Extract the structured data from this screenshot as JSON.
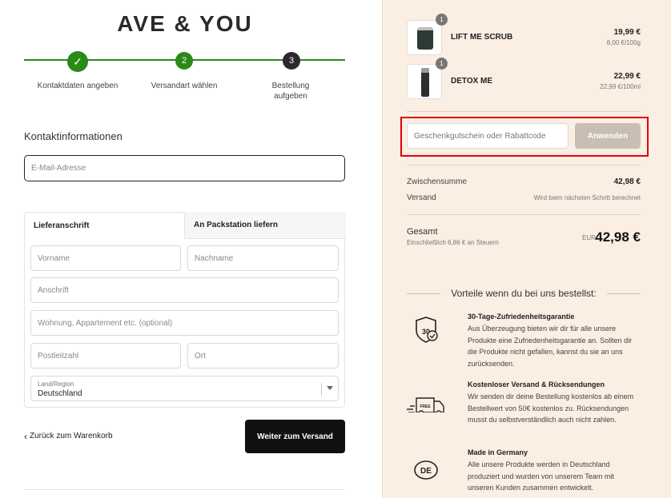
{
  "brand": {
    "logo_text": "AVE & YOU"
  },
  "steps": [
    {
      "label": "Kontaktdaten angeben",
      "marker": "✓"
    },
    {
      "label": "Versandart wählen",
      "marker": "2"
    },
    {
      "label": "Bestellung aufgeben",
      "marker": "3"
    }
  ],
  "contact": {
    "title": "Kontaktinformationen",
    "email_placeholder": "E-Mail-Adresse"
  },
  "shipping": {
    "tabs": [
      "Lieferanschrift",
      "An Packstation liefern"
    ],
    "fields": {
      "vorname": "Vorname",
      "nachname": "Nachname",
      "anschrift": "Anschrift",
      "wohnung": "Wohnung, Appartement etc. (optional)",
      "plz": "Postleitzahl",
      "ort": "Ort"
    },
    "country_label": "Land/Region",
    "country_value": "Deutschland"
  },
  "actions": {
    "back_label": "Zurück zum Warenkorb",
    "continue_label": "Weiter zum Versand"
  },
  "cart": {
    "items": [
      {
        "name": "LIFT ME SCRUB",
        "qty": "1",
        "price": "19,99 €",
        "unit_price": "8,00 €/100g"
      },
      {
        "name": "DETOX ME",
        "qty": "1",
        "price": "22,99 €",
        "unit_price": "22,99 €/100ml"
      }
    ],
    "coupon_placeholder": "Geschenkgutschein oder Rabattcode",
    "apply_label": "Anwenden",
    "subtotal_label": "Zwischensumme",
    "subtotal_value": "42,98 €",
    "shipping_label": "Versand",
    "shipping_value": "Wird beim nächsten Schritt berechnet",
    "total_label": "Gesamt",
    "total_tax_note": "Einschließlich 6,86 € an Steuern",
    "currency": "EUR",
    "total_value": "42,98 €"
  },
  "benefits": {
    "heading": "Vorteile wenn du bei uns bestellst:",
    "items": [
      {
        "icon": "satisfaction-30-icon",
        "title": "30-Tage-Zufriedenheitsgarantie",
        "text": "Aus Überzeugung bieten wir dir für alle unsere Produkte eine Zufriedenheitsgarantie an. Sollten dir die Produkte nicht gefallen, kannst du sie an uns zurücksenden."
      },
      {
        "icon": "free-truck-icon",
        "title": "Kostenloser Versand & Rücksendungen",
        "text": "Wir senden dir deine Bestellung kostenlos ab einem Bestellwert von 50€ kostenlos zu. Rücksendungen musst du selbstverständlich auch nicht zahlen."
      },
      {
        "icon": "made-in-de-icon",
        "title": "Made in Germany",
        "text": "Alle unsere Produkte werden in Deutschland produziert und wurden von unserem Team mit unseren Kunden zusammen entwickelt."
      }
    ],
    "icon_30_text": "30",
    "icon_free_text": "FREE",
    "icon_de_text": "DE"
  },
  "colors": {
    "accent_green": "#2a8a17",
    "panel_bg": "#fbeee3",
    "highlight_red": "#e0000b"
  }
}
